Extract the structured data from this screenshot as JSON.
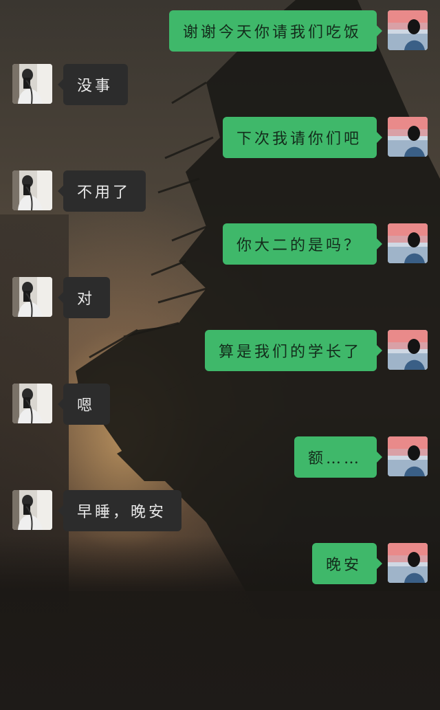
{
  "chat": {
    "messages": [
      {
        "from": "me",
        "text": "谢谢今天你请我们吃饭"
      },
      {
        "from": "them",
        "text": "没事"
      },
      {
        "from": "me",
        "text": "下次我请你们吧"
      },
      {
        "from": "them",
        "text": "不用了"
      },
      {
        "from": "me",
        "text": "你大二的是吗？"
      },
      {
        "from": "them",
        "text": "对"
      },
      {
        "from": "me",
        "text": "算是我们的学长了"
      },
      {
        "from": "them",
        "text": "嗯"
      },
      {
        "from": "me",
        "text": "额……"
      },
      {
        "from": "them",
        "text": "早睡，晚安"
      },
      {
        "from": "me",
        "text": "晚安"
      }
    ]
  },
  "colors": {
    "sent_bubble": "#3fb86a",
    "received_bubble": "#2c2c2c"
  },
  "avatars": {
    "me": "girl-at-sunset-avatar",
    "them": "mirror-selfie-avatar"
  }
}
